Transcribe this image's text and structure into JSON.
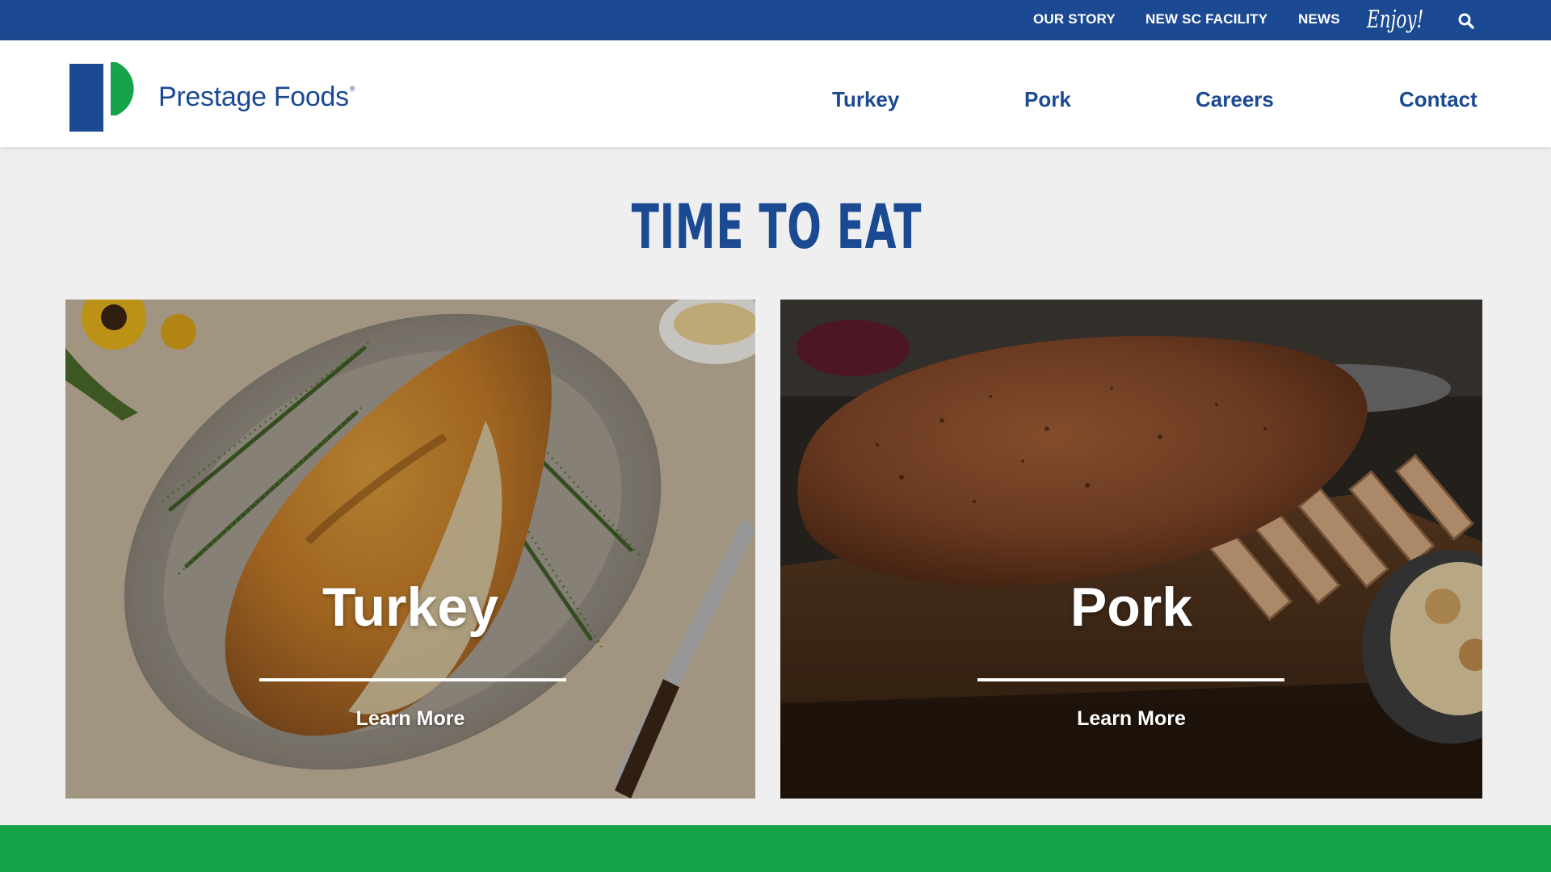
{
  "colors": {
    "brand_blue": "#1b4a92",
    "brand_green": "#16a34a",
    "page_bg": "#efefef"
  },
  "utility_nav": {
    "items": [
      "OUR STORY",
      "NEW SC FACILITY",
      "NEWS"
    ],
    "enjoy_label": "Enjoy!",
    "search_icon": "search-icon"
  },
  "header": {
    "logo_text": "Prestage Foods",
    "logo_mark": "®",
    "nav": [
      "Turkey",
      "Pork",
      "Careers",
      "Contact"
    ]
  },
  "hero": {
    "headline": "TIME TO EAT"
  },
  "cards": [
    {
      "title": "Turkey",
      "link_label": "Learn More",
      "image": "roasted-turkey-breast-photo"
    },
    {
      "title": "Pork",
      "link_label": "Learn More",
      "image": "roasted-pork-rack-photo"
    }
  ]
}
